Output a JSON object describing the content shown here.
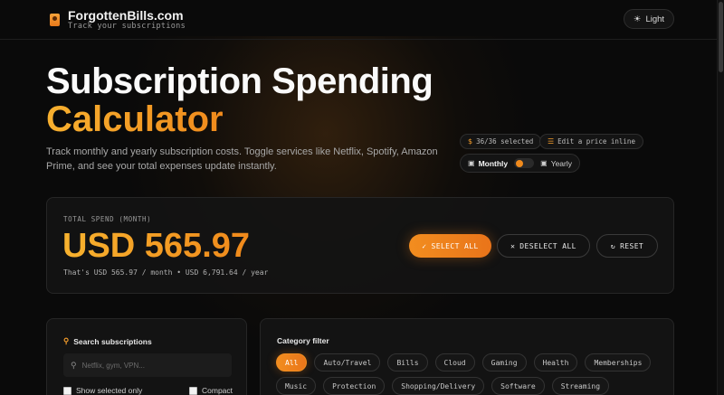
{
  "header": {
    "brand": "ForgottenBills.com",
    "tagline": "Track your subscriptions",
    "theme_toggle": "Light"
  },
  "hero": {
    "title_line1": "Subscription Spending",
    "title_line2": "Calculator",
    "description": "Track monthly and yearly subscription costs. Toggle services like Netflix, Spotify, Amazon Prime, and see your total expenses update instantly."
  },
  "chips": {
    "selected_count": "36/36 selected",
    "edit_hint": "Edit a price inline"
  },
  "billing_toggle": {
    "monthly": "Monthly",
    "yearly": "Yearly",
    "current": "Monthly"
  },
  "summary": {
    "label": "TOTAL SPEND (MONTH)",
    "value": "USD 565.97",
    "subtext": "That's USD 565.97 / month • USD 6,791.64 / year"
  },
  "actions": {
    "select_all": "SELECT ALL",
    "deselect_all": "DESELECT ALL",
    "reset": "RESET"
  },
  "search": {
    "title": "Search subscriptions",
    "placeholder": "Netflix, gym, VPN...",
    "value": "",
    "show_selected_only": "Show selected only",
    "compact": "Compact"
  },
  "filter": {
    "title": "Category filter",
    "categories": [
      "All",
      "Auto/Travel",
      "Bills",
      "Cloud",
      "Gaming",
      "Health",
      "Memberships",
      "Music",
      "Protection",
      "Shopping/Delivery",
      "Software",
      "Streaming"
    ],
    "active": "All"
  },
  "colors": {
    "accent": "#f28d1f",
    "accent_light": "#f7b02f",
    "background": "#0a0a0a"
  }
}
